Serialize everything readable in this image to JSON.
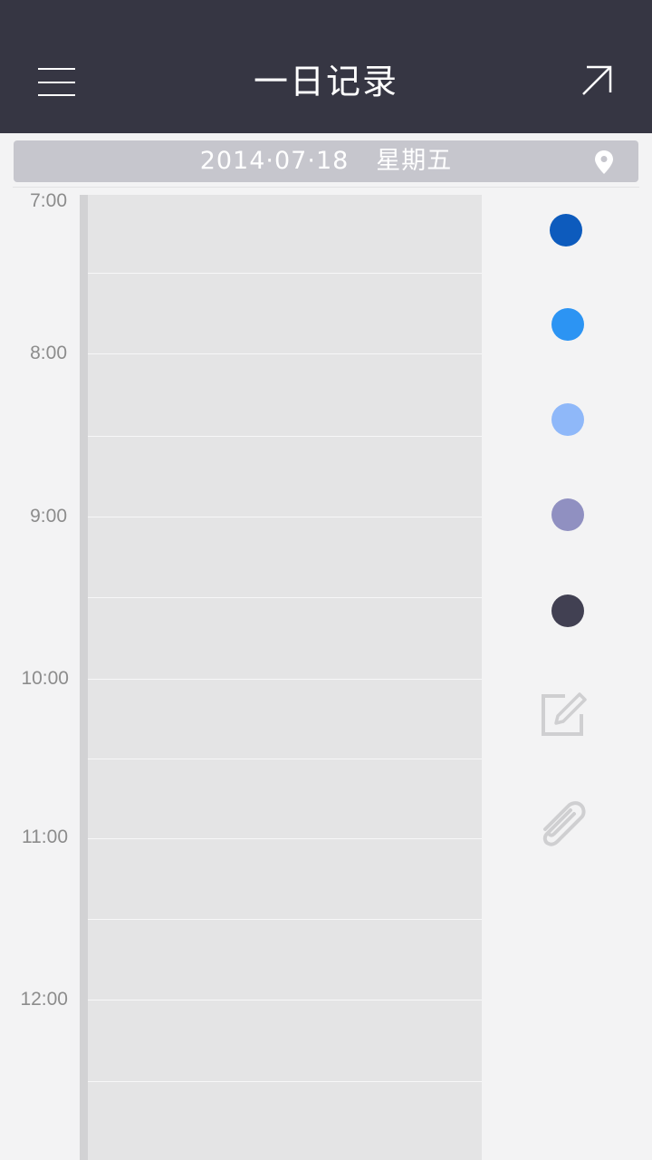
{
  "header": {
    "title": "一日记录",
    "menu_icon": "hamburger-menu-icon",
    "share_icon": "arrow-up-right-icon"
  },
  "date_bar": {
    "date": "2014·07·18",
    "weekday": "星期五",
    "location_icon": "location-pin-icon"
  },
  "timeline": {
    "hours": [
      "7:00",
      "8:00",
      "9:00",
      "10:00",
      "11:00",
      "12:00"
    ]
  },
  "side_tools": {
    "color_dots": [
      "#0d5bbd",
      "#2c94f3",
      "#8fb8f9",
      "#9090c1",
      "#414052"
    ],
    "edit_icon": "edit-note-icon",
    "attach_icon": "paperclip-icon"
  },
  "colors": {
    "header_bg": "#363643",
    "date_bar_bg": "#c6c6cd",
    "page_bg": "#f3f3f4",
    "timeline_bg": "#e4e4e5",
    "icon_gray": "#cfcfd1"
  }
}
